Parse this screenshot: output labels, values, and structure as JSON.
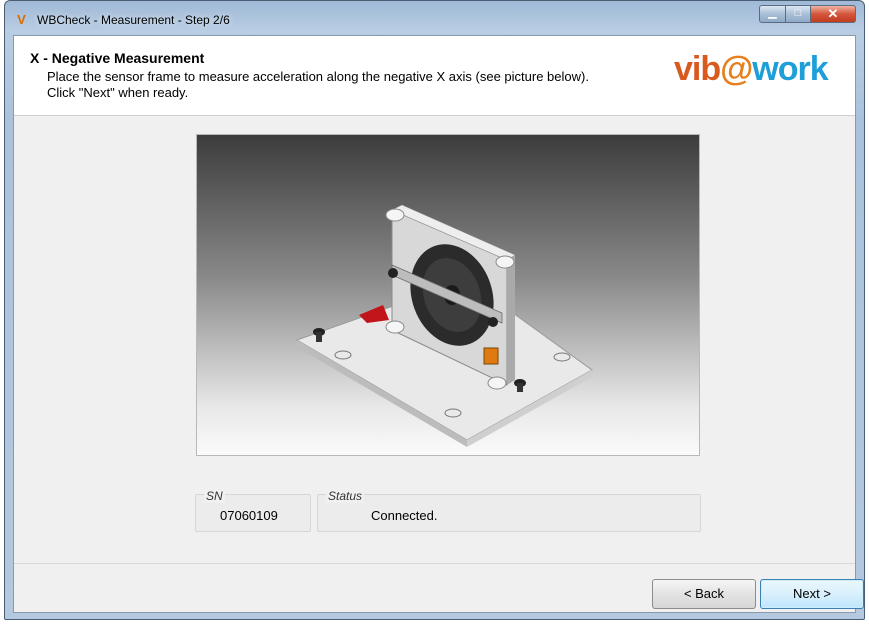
{
  "window": {
    "title": "WBCheck - Measurement - Step 2/6",
    "app_icon": "wbcheck-app-icon",
    "minimize_icon": "minimize-icon",
    "maximize_icon": "maximize-icon",
    "close_icon": "close-icon"
  },
  "header": {
    "title": "X - Negative Measurement",
    "description": "Place the sensor frame to measure acceleration along the negative X axis (see picture below).\nClick \"Next\" when ready.",
    "logo": {
      "part1": "vib",
      "part2": "@",
      "part3": "work"
    }
  },
  "illustration": {
    "icon": "sensor-frame-illustration"
  },
  "sn": {
    "label": "SN",
    "value": "07060109"
  },
  "status": {
    "label": "Status",
    "value": "Connected."
  },
  "buttons": {
    "back": "< Back",
    "next": "Next >"
  },
  "colors": {
    "logo_orange": "#d95a1f",
    "logo_blue": "#1f9fd8",
    "title_bar": "#b9cde3",
    "next_button": "#bee6fd"
  }
}
